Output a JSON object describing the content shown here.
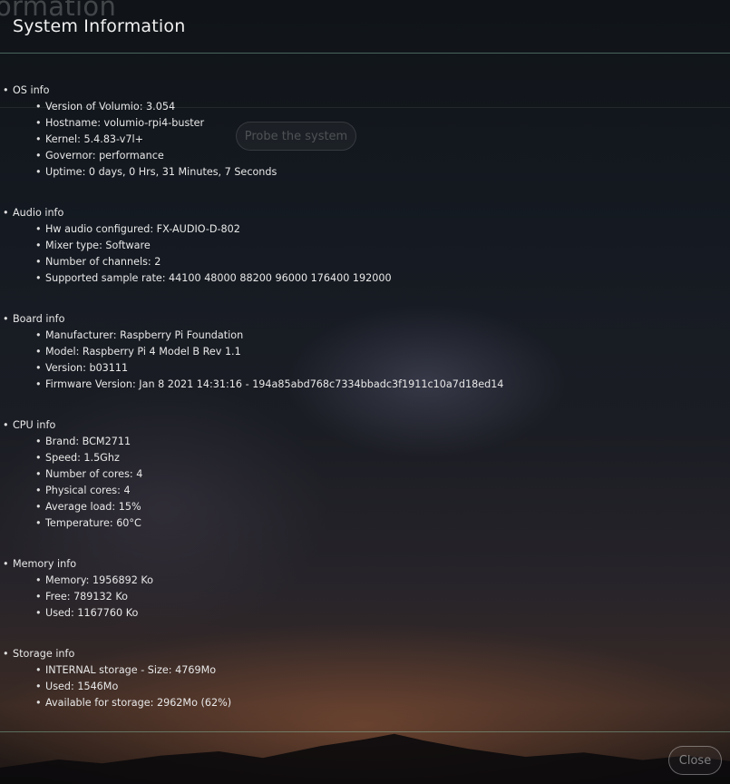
{
  "background": {
    "title_fragment": "ormation",
    "probe_button_label": "Probe the system"
  },
  "modal": {
    "title": "System Information",
    "close_label": "Close"
  },
  "sections": [
    {
      "label": "OS info",
      "items": [
        "Version of Volumio: 3.054",
        "Hostname: volumio-rpi4-buster",
        "Kernel: 5.4.83-v7l+",
        "Governor: performance",
        "Uptime: 0 days, 0 Hrs, 31 Minutes, 7 Seconds"
      ]
    },
    {
      "label": "Audio info",
      "items": [
        "Hw audio configured: FX-AUDIO-D-802",
        "Mixer type: Software",
        "Number of channels: 2",
        "Supported sample rate: 44100 48000 88200 96000 176400 192000"
      ]
    },
    {
      "label": "Board info",
      "items": [
        "Manufacturer: Raspberry Pi Foundation",
        "Model: Raspberry Pi 4 Model B Rev 1.1",
        "Version: b03111",
        "Firmware Version: Jan 8 2021 14:31:16 - 194a85abd768c7334bbadc3f1911c10a7d18ed14"
      ]
    },
    {
      "label": "CPU info",
      "items": [
        "Brand: BCM2711",
        "Speed: 1.5Ghz",
        "Number of cores: 4",
        "Physical cores: 4",
        "Average load: 15%",
        "Temperature: 60°C"
      ]
    },
    {
      "label": "Memory info",
      "items": [
        "Memory: 1956892 Ko",
        "Free: 789132 Ko",
        "Used: 1167760 Ko"
      ]
    },
    {
      "label": "Storage info",
      "items": [
        "INTERNAL storage - Size: 4769Mo",
        "Used: 1546Mo",
        "Available for storage: 2962Mo (62%)"
      ]
    }
  ]
}
